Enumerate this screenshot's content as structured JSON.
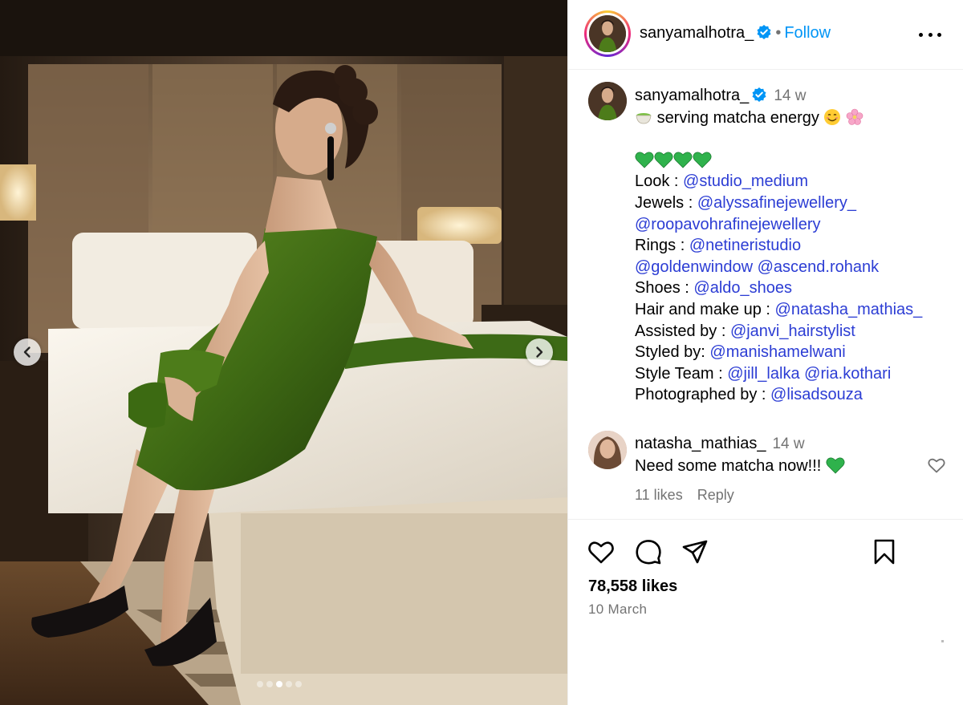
{
  "post": {
    "username": "sanyamalhotra_",
    "verified": true,
    "separator": "•",
    "follow_label": "Follow",
    "more_icon": "more-options-icon"
  },
  "carousel": {
    "slide_count": 5,
    "active_index": 2,
    "prev_icon": "chevron-left-icon",
    "next_icon": "chevron-right-icon"
  },
  "caption": {
    "username": "sanyamalhotra_",
    "time_ago": "14 w",
    "line1": "serving matcha energy",
    "lines": [
      {
        "label": "Look : ",
        "mentions": [
          "@studio_medium"
        ]
      },
      {
        "label": "Jewels : ",
        "mentions": [
          "@alyssafinejewellery_"
        ]
      },
      {
        "label": "",
        "mentions": [
          "@roopavohrafinejewellery"
        ]
      },
      {
        "label": "Rings : ",
        "mentions": [
          "@netineristudio"
        ]
      },
      {
        "label": "",
        "mentions": [
          "@goldenwindow",
          "@ascend.rohank"
        ]
      },
      {
        "label": "Shoes : ",
        "mentions": [
          "@aldo_shoes"
        ]
      },
      {
        "label": "Hair and make up : ",
        "mentions": [
          "@natasha_mathias_"
        ]
      },
      {
        "label": "Assisted by : ",
        "mentions": [
          "@janvi_hairstylist"
        ]
      },
      {
        "label": "Styled by: ",
        "mentions": [
          "@manishamelwani"
        ]
      },
      {
        "label": "Style Team : ",
        "mentions": [
          "@jill_lalka",
          "@ria.kothari"
        ]
      },
      {
        "label": "Photographed by : ",
        "mentions": [
          "@lisadsouza"
        ]
      }
    ]
  },
  "comment": {
    "username": "natasha_mathias_",
    "time_ago": "14 w",
    "text": "Need some matcha now!!!",
    "likes": "11 likes",
    "reply_label": "Reply"
  },
  "footer": {
    "likes": "78,558 likes",
    "date": "10 March"
  },
  "colors": {
    "accent": "#0095f6",
    "mention": "#2c3dd4",
    "muted": "#737373",
    "heart_green": "#2fb24c"
  }
}
